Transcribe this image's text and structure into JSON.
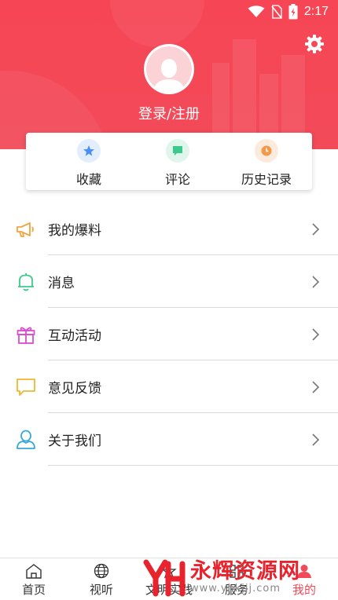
{
  "status_bar": {
    "time": "2:17"
  },
  "profile": {
    "login_label": "登录/注册"
  },
  "quick_actions": [
    {
      "label": "收藏",
      "icon": "star-icon",
      "color": "#4a8ff5",
      "bg": "#e3eefc"
    },
    {
      "label": "评论",
      "icon": "comment-icon",
      "color": "#3cc98c",
      "bg": "#e0f6ec"
    },
    {
      "label": "历史记录",
      "icon": "clock-icon",
      "color": "#f29a4a",
      "bg": "#fcebdc"
    }
  ],
  "menu": [
    {
      "label": "我的爆料",
      "icon": "megaphone-icon",
      "color": "#f0a440"
    },
    {
      "label": "消息",
      "icon": "bell-icon",
      "color": "#3cc98c"
    },
    {
      "label": "互动活动",
      "icon": "gift-icon",
      "color": "#d94fd0"
    },
    {
      "label": "意见反馈",
      "icon": "feedback-bubble-icon",
      "color": "#f2b531"
    },
    {
      "label": "关于我们",
      "icon": "user-icon",
      "color": "#3aa6d8"
    }
  ],
  "bottom_nav": [
    {
      "label": "首页",
      "icon": "home-icon"
    },
    {
      "label": "视听",
      "icon": "globe-icon"
    },
    {
      "label": "文明实践",
      "icon": "practice-icon"
    },
    {
      "label": "服务",
      "icon": "service-icon"
    },
    {
      "label": "我的",
      "icon": "profile-icon"
    }
  ],
  "watermark": {
    "title": "永辉资源网",
    "url": "www.yhkjjj.com"
  },
  "colors": {
    "brand_red": "#f24a58",
    "divider": "#d9d9d9"
  }
}
